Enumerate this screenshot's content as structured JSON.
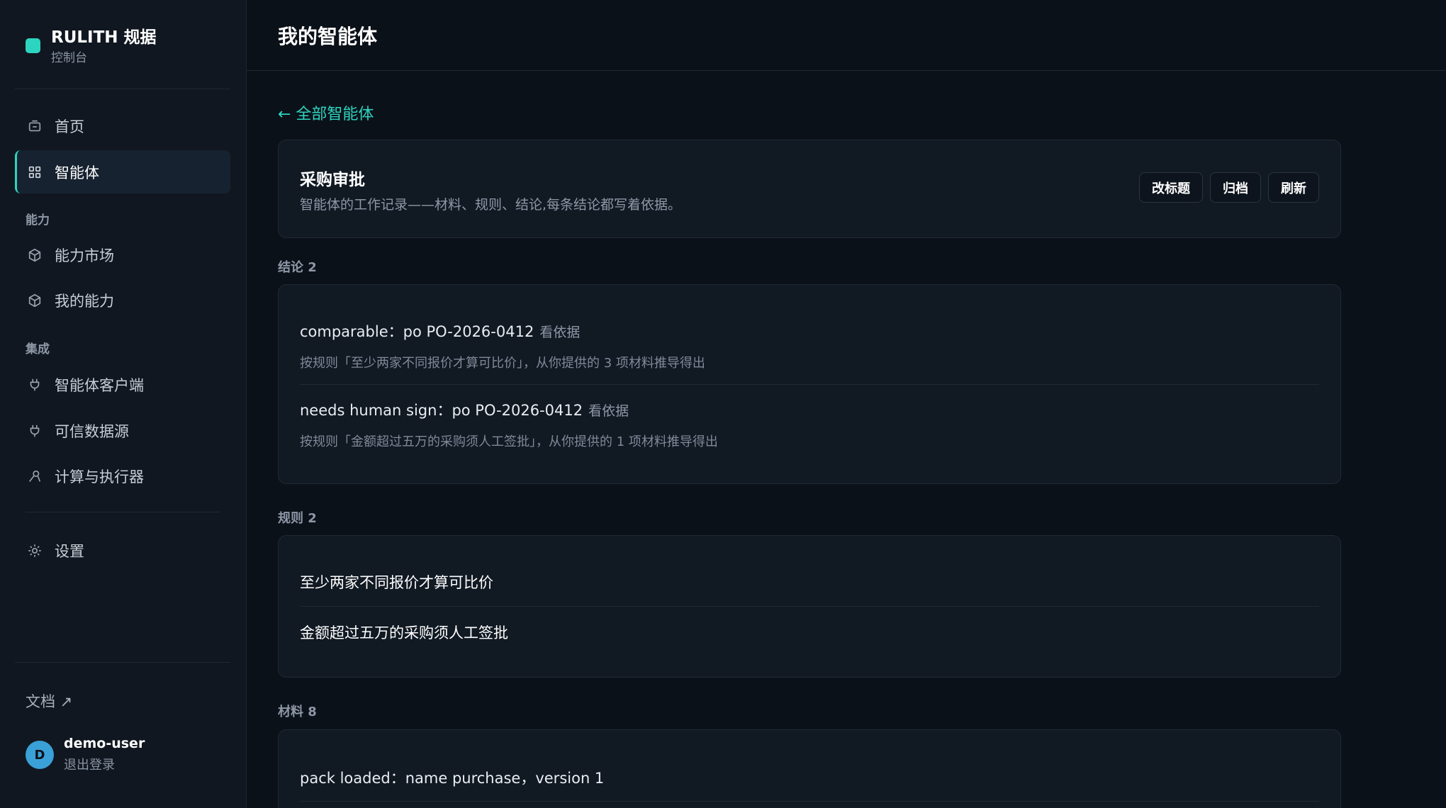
{
  "sidebar": {
    "brand_name": "RULITH 规据",
    "brand_sub": "控制台",
    "nav": {
      "home": "首页",
      "agents": "智能体"
    },
    "section_capability": "能力",
    "capability": {
      "market": "能力市场",
      "mine": "我的能力"
    },
    "section_integration": "集成",
    "integration": {
      "client": "智能体客户端",
      "datasource": "可信数据源",
      "executor": "计算与执行器"
    },
    "settings": "设置",
    "docs": "文档 ↗",
    "user": {
      "avatar_letter": "D",
      "name": "demo-user",
      "logout": "退出登录"
    }
  },
  "header": {
    "title": "我的智能体"
  },
  "main": {
    "back_link": "← 全部智能体",
    "agent": {
      "title": "采购审批",
      "description": "智能体的工作记录——材料、规则、结论,每条结论都写着依据。",
      "buttons": {
        "rename": "改标题",
        "archive": "归档",
        "refresh": "刷新"
      }
    },
    "conclusions": {
      "heading": "结论 2",
      "items": [
        {
          "text": "comparable：po PO-2026-0412",
          "link": "看依据",
          "detail": "按规则「至少两家不同报价才算可比价」，从你提供的 3 项材料推导得出"
        },
        {
          "text": "needs human sign：po PO-2026-0412",
          "link": "看依据",
          "detail": "按规则「金额超过五万的采购须人工签批」，从你提供的 1 项材料推导得出"
        }
      ]
    },
    "rules": {
      "heading": "规则 2",
      "items": [
        "至少两家不同报价才算可比价",
        "金额超过五万的采购须人工签批"
      ]
    },
    "materials": {
      "heading": "材料 8",
      "items": [
        "pack loaded：name purchase，version 1"
      ]
    }
  }
}
